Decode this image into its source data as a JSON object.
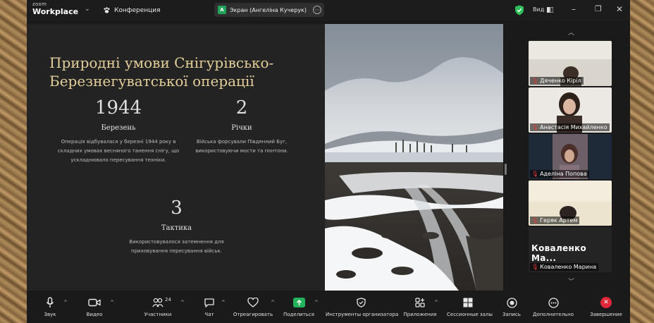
{
  "app": {
    "brand_small": "zoom",
    "brand_large": "Workplace",
    "meeting_label": "Конференция",
    "screen_share_avatar": "А",
    "screen_share_label": "Экран (Ангеліна Кучерук)",
    "view_label": "Вид"
  },
  "slide": {
    "title": "Природні умови Снігурівсько-Березнегуватської операції",
    "stats": [
      {
        "number": "1944",
        "heading": "Березень",
        "desc": "Операція відбувалася у березні 1944 року в складних умовах весняного танення снігу, що ускладнювало пересування техніки."
      },
      {
        "number": "2",
        "heading": "Річки",
        "desc": "Війська форсували Південний Буг, використовуючи мости та понтони."
      },
      {
        "number": "3",
        "heading": "Тактика",
        "desc": "Використовувалося затемнення для приховування пересування військ."
      }
    ]
  },
  "participants": [
    {
      "name": "Дяченко Кіріл"
    },
    {
      "name": "Анастасія Михайленко"
    },
    {
      "name": "Аделіна Попова"
    },
    {
      "name": "Геряк Артем"
    },
    {
      "name": "Коваленко Марина",
      "big_label": "Коваленко Ма..."
    }
  ],
  "toolbar": {
    "mute": "Звук",
    "video": "Видео",
    "participants": "Участники",
    "participants_count": "24",
    "chat": "Чат",
    "react": "Отреагировать",
    "share": "Поделиться",
    "host_tools": "Инструменты организатора",
    "apps": "Приложения",
    "breakout": "Сессионные залы",
    "record": "Запись",
    "more": "Дополнительно",
    "end": "Завершение"
  },
  "colors": {
    "title_gold": "#e4cf9a",
    "share_green": "#22b35a",
    "end_red": "#e0283a",
    "shield_green": "#2fbf5b"
  }
}
